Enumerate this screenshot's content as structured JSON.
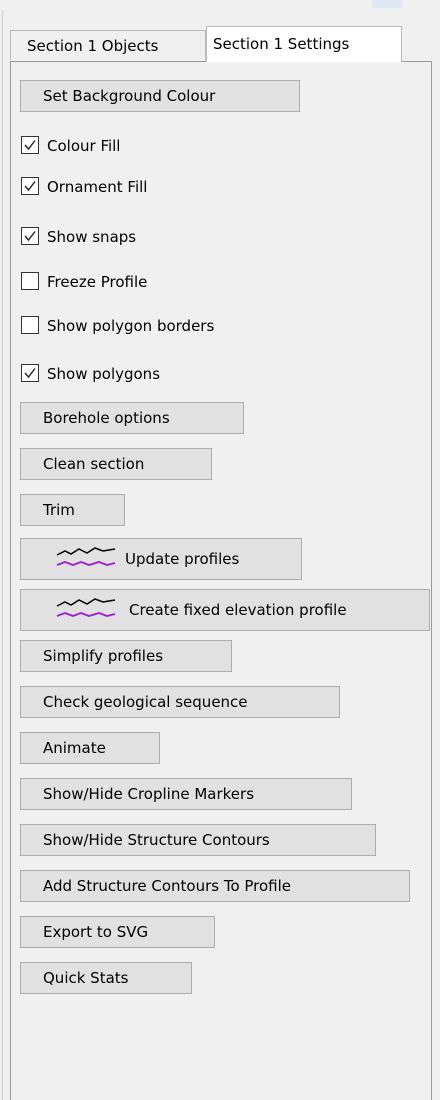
{
  "tabs": [
    {
      "label": "Section 1 Objects"
    },
    {
      "label": "Section 1 Settings"
    }
  ],
  "buttons": {
    "set_background_colour": "Set Background Colour",
    "borehole_options": "Borehole options",
    "clean_section": "Clean section",
    "trim": "Trim",
    "update_profiles": "Update profiles",
    "create_fixed_elevation_profile": "Create fixed elevation profile",
    "simplify_profiles": "Simplify profiles",
    "check_geological_sequence": "Check geological sequence",
    "animate": "Animate",
    "show_hide_cropline_markers": "Show/Hide Cropline Markers",
    "show_hide_structure_contours": "Show/Hide Structure Contours",
    "add_structure_contours_to_profile": "Add Structure Contours To Profile",
    "export_to_svg": "Export to SVG",
    "quick_stats": "Quick Stats"
  },
  "checkboxes": [
    {
      "label": "Colour Fill",
      "checked": true
    },
    {
      "label": "Ornament Fill",
      "checked": true
    },
    {
      "label": "Show snaps",
      "checked": true
    },
    {
      "label": "Freeze Profile",
      "checked": false
    },
    {
      "label": "Show polygon borders",
      "checked": false
    },
    {
      "label": "Show polygons",
      "checked": true
    }
  ],
  "icons": {
    "profile_icon": "profile-lines-icon"
  },
  "colors": {
    "profile_line_dark": "#000000",
    "profile_line_accent": "#9b1fd1"
  }
}
